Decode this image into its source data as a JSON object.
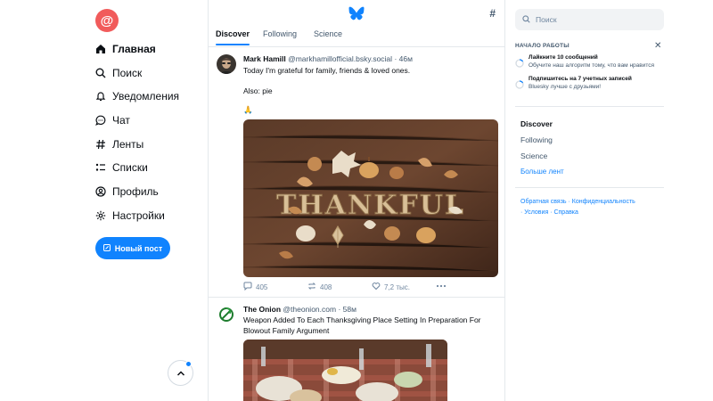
{
  "nav": {
    "items": [
      {
        "label": "Главная",
        "icon": "home-icon"
      },
      {
        "label": "Поиск",
        "icon": "search-icon"
      },
      {
        "label": "Уведомления",
        "icon": "bell-icon"
      },
      {
        "label": "Чат",
        "icon": "chat-icon"
      },
      {
        "label": "Ленты",
        "icon": "hash-icon"
      },
      {
        "label": "Списки",
        "icon": "list-icon"
      },
      {
        "label": "Профиль",
        "icon": "profile-icon"
      },
      {
        "label": "Настройки",
        "icon": "gear-icon"
      }
    ],
    "new_post": "Новый пост"
  },
  "feed": {
    "tabs": [
      "Discover",
      "Following",
      "Science"
    ],
    "posts": [
      {
        "name": "Mark Hamill",
        "handle": "@markhamillofficial.bsky.social",
        "time": "· 46м",
        "line1": "Today I'm grateful for family, friends & loved ones.",
        "line2": "Also: pie",
        "emoji": "🙏",
        "image_text": "THANKFUL",
        "replies": "405",
        "reposts": "408",
        "likes": "7,2 тыс."
      },
      {
        "name": "The Onion",
        "handle": "@theonion.com",
        "time": "· 58м",
        "line1": "Weapon Added To Each Thanksgiving Place Setting In Preparation For",
        "line2": "Blowout Family Argument"
      }
    ]
  },
  "right": {
    "search_placeholder": "Поиск",
    "getting_started": "НАЧАЛО РАБОТЫ",
    "tasks": [
      {
        "title": "Лайкните 10 сообщений",
        "desc": "Обучите наш алгоритм тому, что вам нравится"
      },
      {
        "title": "Подпишитесь на 7 учетных записей",
        "desc": "Bluesky лучше с друзьями!"
      }
    ],
    "feeds": [
      "Discover",
      "Following",
      "Science"
    ],
    "more_feeds": "Больше лент",
    "footer_line1": "Обратная связь · Конфиденциальность",
    "footer_line2": "· Условия · Справка"
  },
  "colors": {
    "accent": "#1083fe",
    "avatar": "#f15b5b"
  }
}
